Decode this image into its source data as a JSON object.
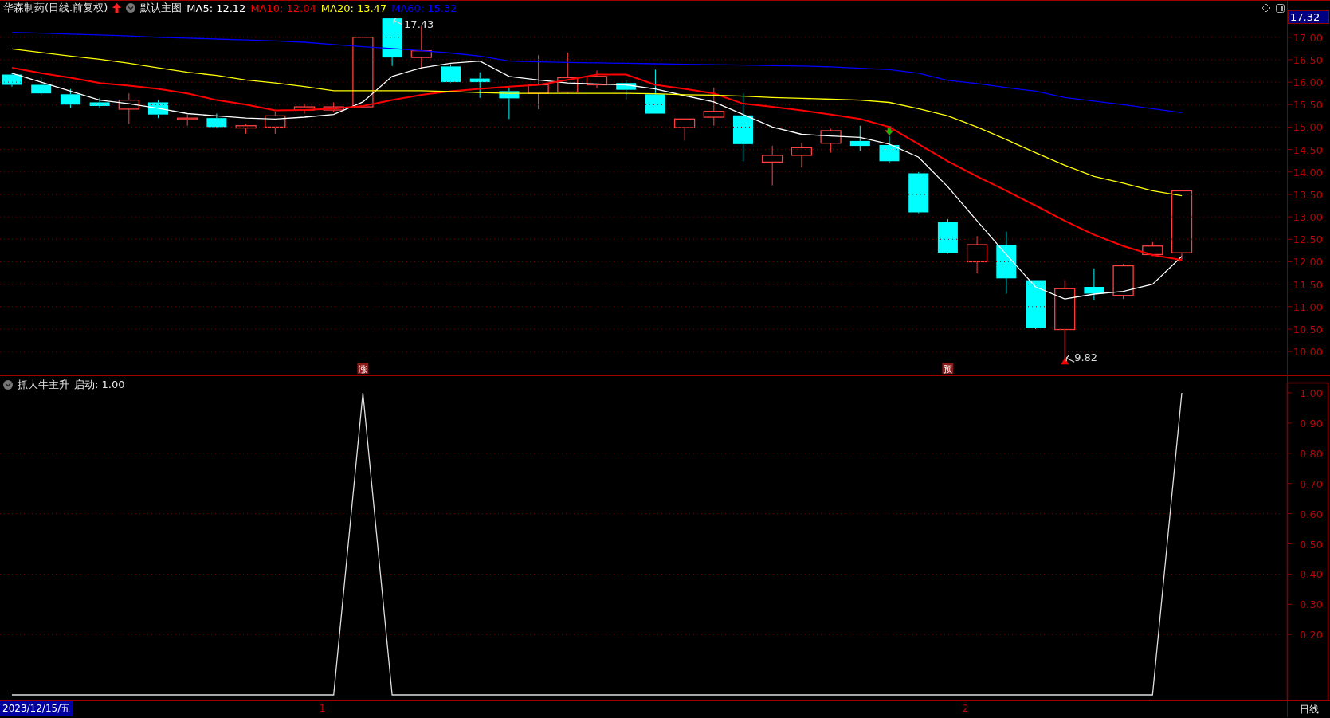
{
  "header": {
    "title": "华森制药(日线.前复权)",
    "main_chart": "默认主图",
    "indicators": [
      {
        "label": "MA5: 12.12",
        "color": "#ffffff"
      },
      {
        "label": "MA10: 12.04",
        "color": "#ff0000"
      },
      {
        "label": "MA20: 13.47",
        "color": "#ffff00"
      },
      {
        "label": "MA60: 15.32",
        "color": "#0000ff"
      }
    ]
  },
  "price_pane": {
    "current_price": "17.32",
    "high_label": "17.43",
    "low_label": "9.82",
    "signals": [
      "涨",
      "预"
    ],
    "chart_data": {
      "type": "line",
      "grid": true,
      "ylim": [
        9.47,
        17.83
      ],
      "yticks": [
        {
          "value": 17,
          "label": "17.00"
        },
        {
          "value": 16.5,
          "label": "16.50"
        },
        {
          "value": 16,
          "label": "16.00"
        },
        {
          "value": 15.5,
          "label": "15.50"
        },
        {
          "value": 15,
          "label": "15.00"
        },
        {
          "value": 14.5,
          "label": "14.50"
        },
        {
          "value": 14,
          "label": "14.00"
        },
        {
          "value": 13.5,
          "label": "13.50"
        },
        {
          "value": 13,
          "label": "13.00"
        },
        {
          "value": 12.5,
          "label": "12.50"
        },
        {
          "value": 12,
          "label": "12.00"
        },
        {
          "value": 11.5,
          "label": "11.50"
        },
        {
          "value": 11,
          "label": "11.00"
        },
        {
          "value": 10.5,
          "label": "10.50"
        },
        {
          "value": 10,
          "label": "10.00"
        }
      ],
      "series": [
        {
          "color": "#ffffff",
          "values": [
            16.2,
            16.0,
            15.8,
            15.6,
            15.52,
            15.42,
            15.3,
            15.25,
            15.2,
            15.18,
            15.22,
            15.28,
            15.56,
            16.13,
            16.32,
            16.42,
            16.47,
            16.13,
            16.05,
            15.98,
            15.96,
            15.94,
            15.85,
            15.7,
            15.56,
            15.28,
            15.0,
            14.84,
            14.8,
            14.77,
            14.62,
            14.33,
            13.67,
            12.91,
            12.16,
            11.44,
            11.17,
            11.28,
            11.34,
            11.5,
            12.12
          ]
        },
        {
          "color": "#ff0000",
          "values": [
            16.32,
            16.2,
            16.1,
            15.98,
            15.92,
            15.85,
            15.75,
            15.6,
            15.5,
            15.37,
            15.38,
            15.41,
            15.47,
            15.6,
            15.72,
            15.8,
            15.85,
            15.9,
            15.94,
            16.05,
            16.17,
            16.17,
            15.94,
            15.85,
            15.75,
            15.52,
            15.45,
            15.37,
            15.28,
            15.18,
            15.0,
            14.62,
            14.24,
            13.9,
            13.58,
            13.25,
            12.91,
            12.6,
            12.35,
            12.15,
            12.04
          ]
        },
        {
          "color": "#ffff00",
          "values": [
            16.74,
            16.66,
            16.58,
            16.51,
            16.42,
            16.32,
            16.22,
            16.15,
            16.05,
            15.98,
            15.9,
            15.81,
            15.81,
            15.81,
            15.81,
            15.79,
            15.77,
            15.75,
            15.75,
            15.75,
            15.75,
            15.75,
            15.74,
            15.72,
            15.71,
            15.69,
            15.66,
            15.64,
            15.62,
            15.6,
            15.55,
            15.41,
            15.25,
            15.0,
            14.72,
            14.43,
            14.15,
            13.9,
            13.75,
            13.58,
            13.47
          ]
        },
        {
          "color": "#0000ff",
          "values": [
            17.11,
            17.09,
            17.07,
            17.05,
            17.03,
            17.0,
            16.98,
            16.96,
            16.94,
            16.92,
            16.89,
            16.84,
            16.79,
            16.75,
            16.7,
            16.65,
            16.58,
            16.47,
            16.45,
            16.44,
            16.43,
            16.42,
            16.41,
            16.4,
            16.39,
            16.38,
            16.37,
            16.36,
            16.34,
            16.31,
            16.28,
            16.2,
            16.04,
            15.97,
            15.88,
            15.8,
            15.66,
            15.58,
            15.5,
            15.41,
            15.32
          ]
        }
      ]
    }
  },
  "indicator_pane": {
    "title": "抓大牛主升",
    "reading": "启动: 1.00",
    "chart_data": {
      "type": "line",
      "grid": true,
      "ylim": [
        -0.021,
        1.058
      ],
      "yticks": [
        {
          "value": 1,
          "label": "1.00"
        },
        {
          "value": 0.9,
          "label": "0.90"
        },
        {
          "value": 0.8,
          "label": "0.80"
        },
        {
          "value": 0.7,
          "label": "0.70"
        },
        {
          "value": 0.6,
          "label": "0.60"
        },
        {
          "value": 0.5,
          "label": "0.50"
        },
        {
          "value": 0.4,
          "label": "0.40"
        },
        {
          "value": 0.3,
          "label": "0.30"
        },
        {
          "value": 0.2,
          "label": "0.20"
        }
      ],
      "series": [
        {
          "color": "#e0e0e0",
          "values": [
            0,
            0,
            0,
            0,
            0,
            0,
            0,
            0,
            0,
            0,
            0,
            0,
            1,
            0,
            0,
            0,
            0,
            0,
            0,
            0,
            0,
            0,
            0,
            0,
            0,
            0,
            0,
            0,
            0,
            0,
            0,
            0,
            0,
            0,
            0,
            0,
            0,
            0,
            0,
            0,
            1
          ]
        }
      ]
    }
  },
  "time_axis": {
    "date": "2023/12/15/五",
    "months": [
      "1",
      "2"
    ],
    "period": "日线"
  }
}
